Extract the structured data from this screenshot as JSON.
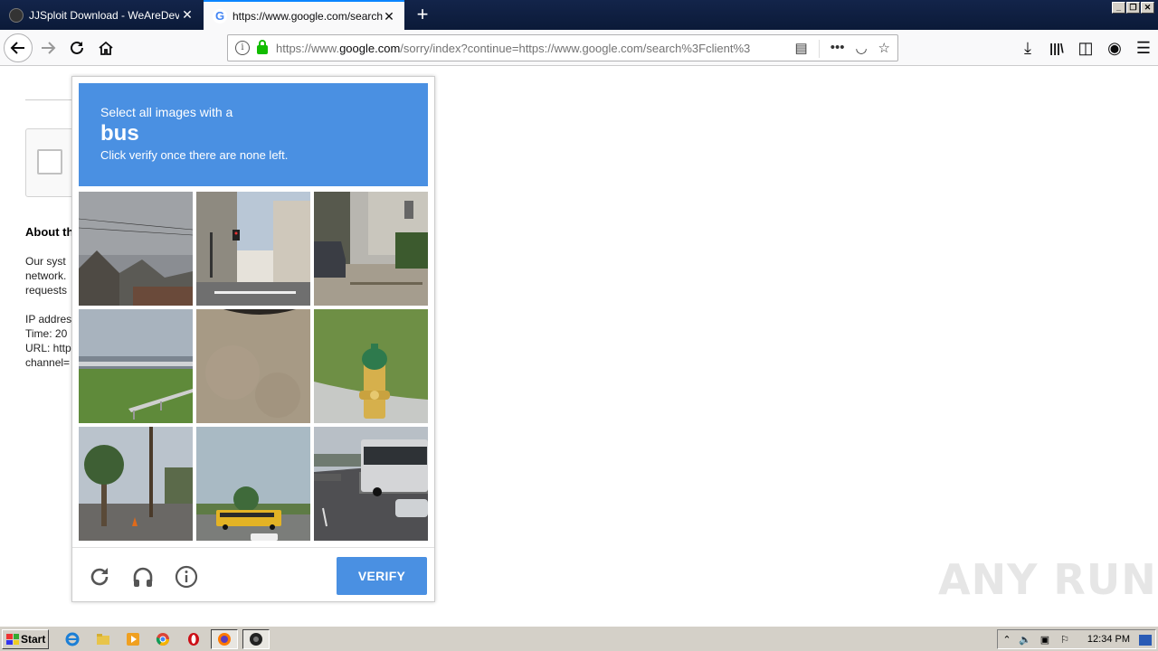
{
  "browser": {
    "tabs": [
      {
        "title": "JJSploit Download - WeAreDevs",
        "active": false
      },
      {
        "title": "https://www.google.com/search?c",
        "active": true
      }
    ],
    "url_prefix": "https://www.",
    "url_domain": "google.com",
    "url_path": "/sorry/index?continue=https://www.google.com/search%3Fclient%3"
  },
  "page": {
    "about_heading": "About th",
    "body_lines_1": [
      "Our syst",
      "network.",
      "requests"
    ],
    "body_lines_2": [
      "IP addres",
      "Time: 20",
      "URL: http",
      "channel="
    ]
  },
  "challenge": {
    "instruction": "Select all images with a",
    "keyword": "bus",
    "subtext": "Click verify once there are none left.",
    "verify_label": "VERIFY",
    "tiles": [
      "rooftops-under-gray-sky",
      "street-intersection-with-traffic-lights",
      "car-parked-by-building",
      "highway-with-guardrail",
      "pavement-closeup",
      "fire-hydrant-on-grass",
      "palm-tree-street",
      "school-bus-on-road",
      "highway-with-bus"
    ]
  },
  "watermark": "ANY RUN",
  "taskbar": {
    "start_label": "Start",
    "clock": "12:34 PM"
  },
  "colors": {
    "challenge_blue": "#4a90e2",
    "lock_green": "#12bc00"
  }
}
